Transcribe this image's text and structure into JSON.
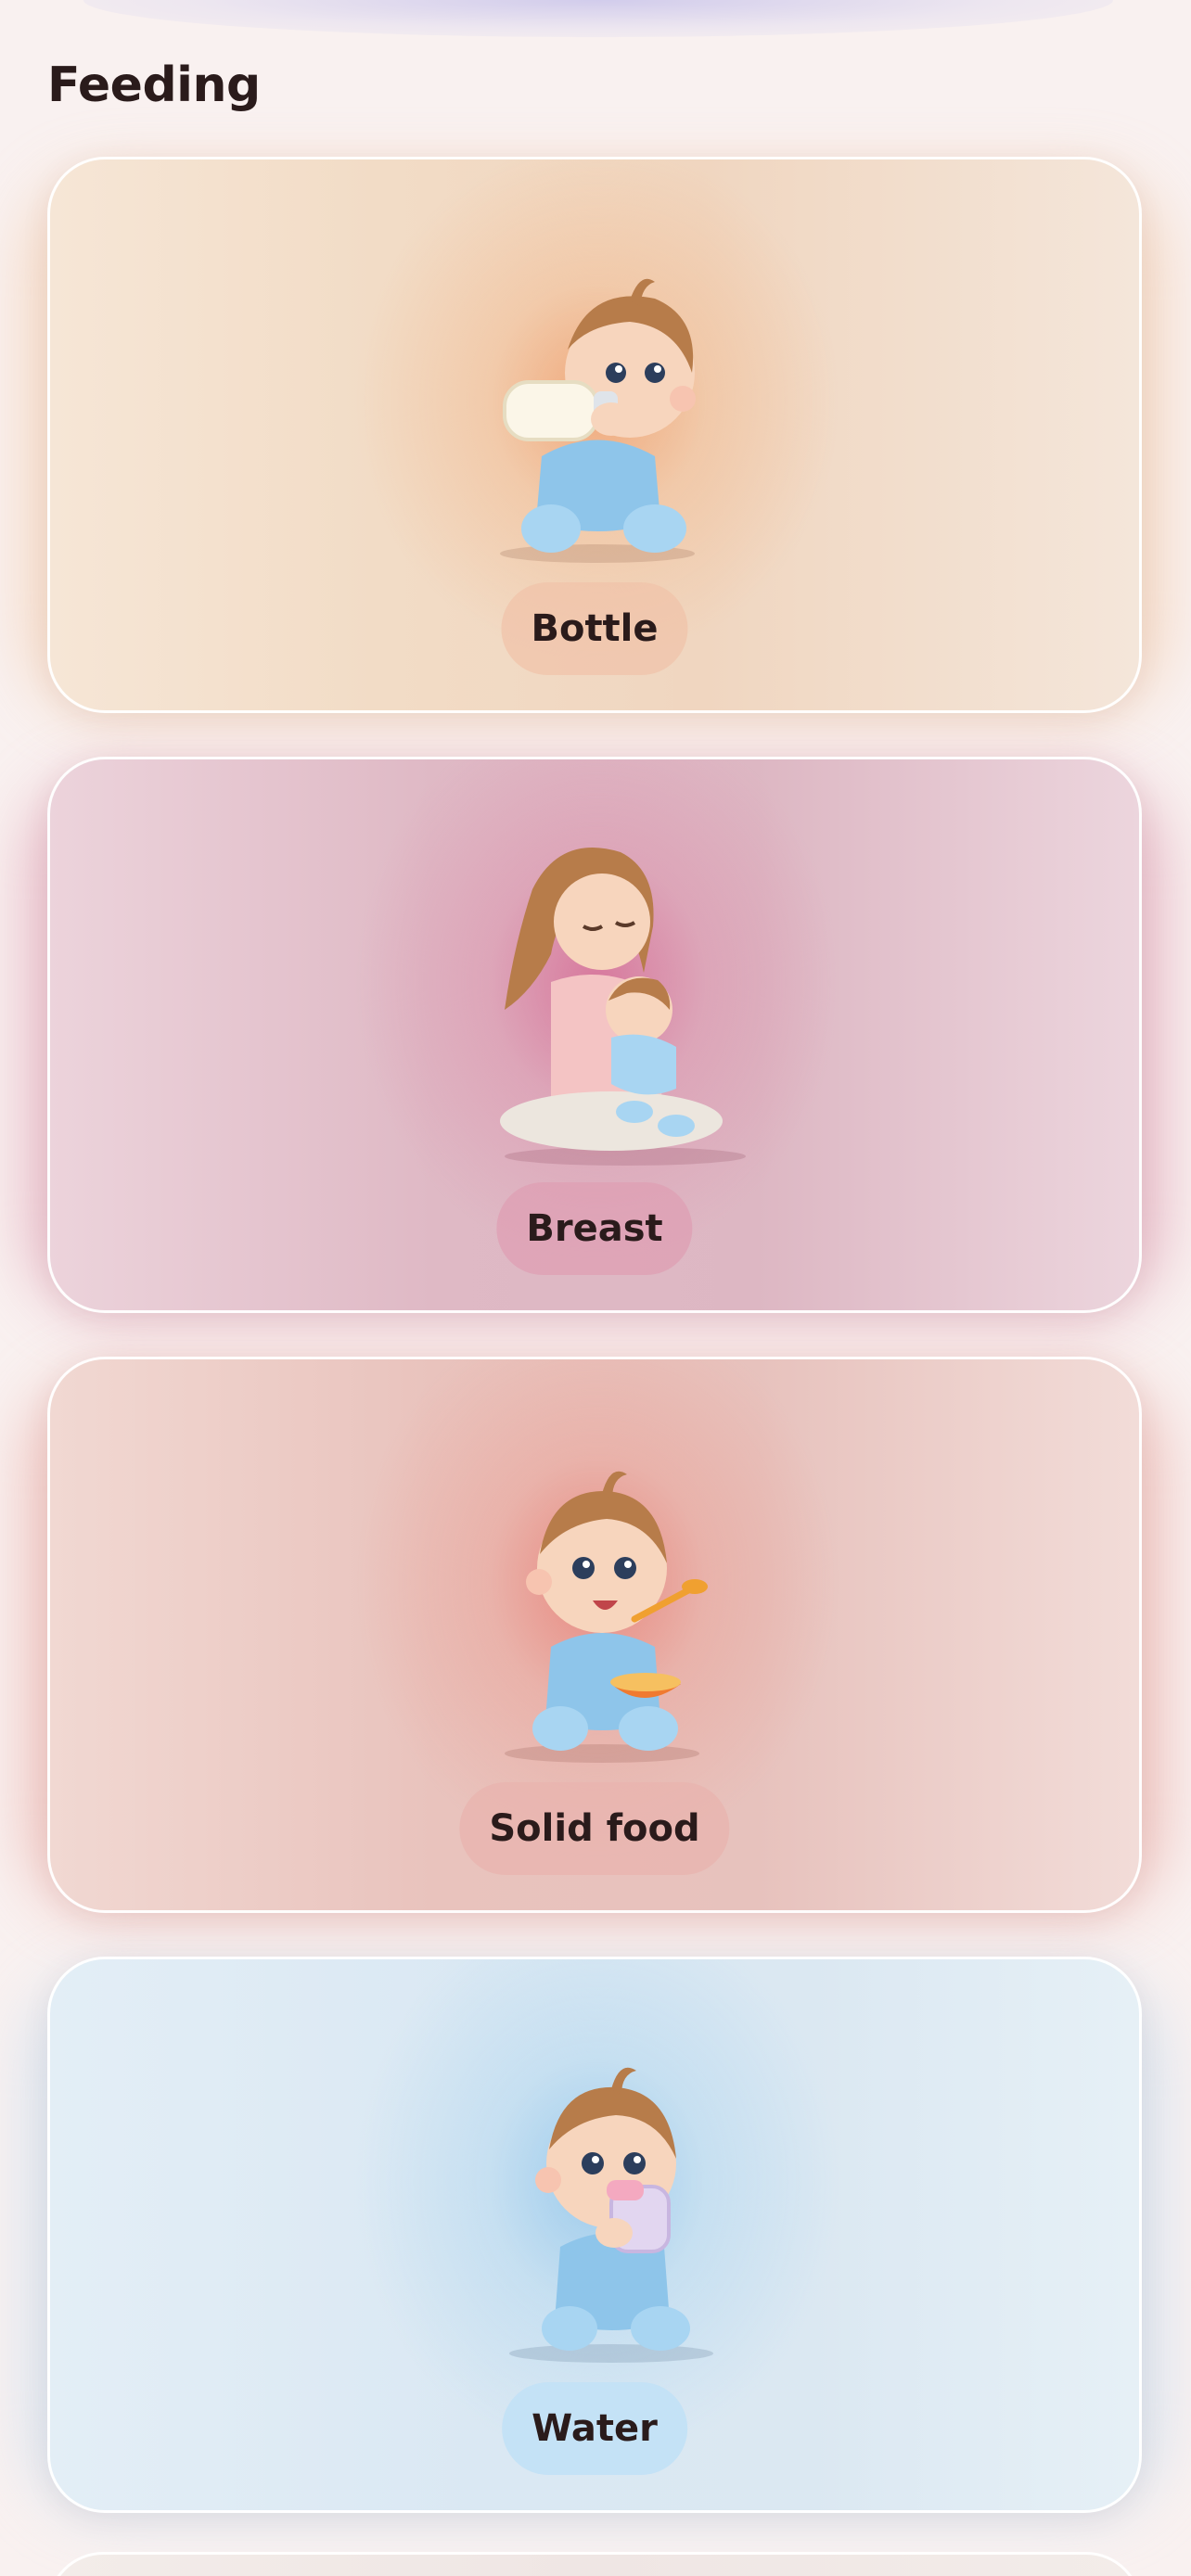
{
  "header": {
    "title": "Feeding"
  },
  "cards": [
    {
      "label": "Bottle",
      "icon": "baby-bottle-icon",
      "accent": "#f0a06e"
    },
    {
      "label": "Breast",
      "icon": "breastfeeding-icon",
      "accent": "#d66e96"
    },
    {
      "label": "Solid food",
      "icon": "baby-eating-icon",
      "accent": "#e88278"
    },
    {
      "label": "Water",
      "icon": "baby-sippy-cup-icon",
      "accent": "#96c8eb"
    }
  ]
}
